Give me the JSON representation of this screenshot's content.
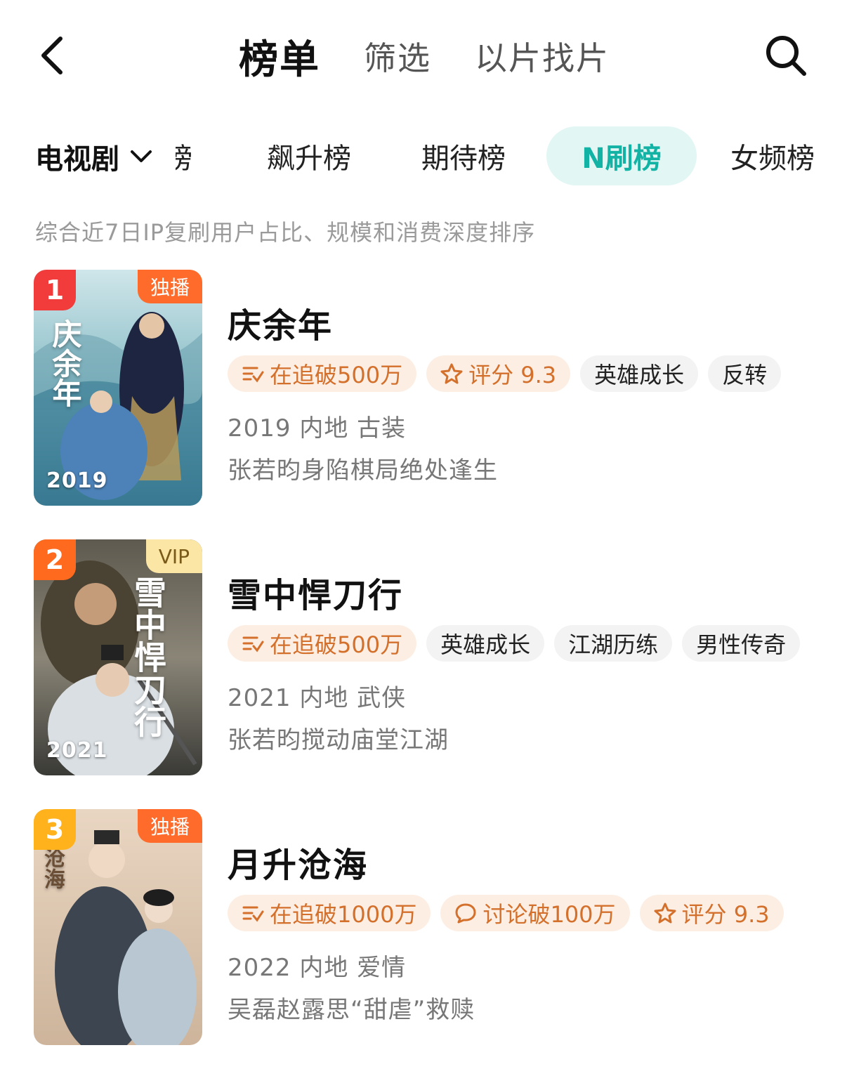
{
  "nav": {
    "tabs": [
      {
        "label": "榜单",
        "active": true
      },
      {
        "label": "筛选",
        "active": false
      },
      {
        "label": "以片找片",
        "active": false
      }
    ],
    "icons": {
      "back": "chevron-left-icon",
      "search": "search-icon"
    }
  },
  "category": {
    "selected": "电视剧",
    "icon": "chevron-down-icon"
  },
  "rank_tabs": [
    {
      "label": "榜",
      "active": false
    },
    {
      "label": "飙升榜",
      "active": false
    },
    {
      "label": "期待榜",
      "active": false
    },
    {
      "label": "N刷榜",
      "active": true
    },
    {
      "label": "女频榜",
      "active": false
    }
  ],
  "description": "综合近7日IP复刷用户占比、规模和消费深度排序",
  "colors": {
    "accent": "#12b3a5",
    "accent_bg": "#e2f6f4",
    "hot_tag_bg": "#fdeee3",
    "hot_tag_text": "#d3702c"
  },
  "items": [
    {
      "rank": "1",
      "rank_color": "#f23c3c",
      "badge": "独播",
      "badge_type": "exclusive",
      "poster_year": "2019",
      "poster_title": "庆余年",
      "title": "庆余年",
      "tags": [
        {
          "text": "在追破500万",
          "icon": "follow-list-icon",
          "style": "hot"
        },
        {
          "text": "评分 9.3",
          "icon": "star-icon",
          "style": "hot"
        },
        {
          "text": "英雄成长",
          "style": "plain"
        },
        {
          "text": "反转",
          "style": "plain"
        }
      ],
      "meta": "2019 内地 古装",
      "subtitle": "张若昀身陷棋局绝处逢生"
    },
    {
      "rank": "2",
      "rank_color": "#ff6a1f",
      "badge": "VIP",
      "badge_type": "vip",
      "poster_year": "2021",
      "poster_title": "雪中悍刀行",
      "title": "雪中悍刀行",
      "tags": [
        {
          "text": "在追破500万",
          "icon": "follow-list-icon",
          "style": "hot"
        },
        {
          "text": "英雄成长",
          "style": "plain"
        },
        {
          "text": "江湖历练",
          "style": "plain"
        },
        {
          "text": "男性传奇",
          "style": "plain"
        }
      ],
      "meta": "2021 内地 武侠",
      "subtitle": "张若昀搅动庙堂江湖"
    },
    {
      "rank": "3",
      "rank_color": "#ffb21c",
      "badge": "独播",
      "badge_type": "exclusive",
      "poster_year": "",
      "poster_title": "沧海",
      "title": "月升沧海",
      "tags": [
        {
          "text": "在追破1000万",
          "icon": "follow-list-icon",
          "style": "hot"
        },
        {
          "text": "讨论破100万",
          "icon": "chat-bubble-icon",
          "style": "hot"
        },
        {
          "text": "评分 9.3",
          "icon": "star-icon",
          "style": "hot"
        }
      ],
      "meta": "2022 内地 爱情",
      "subtitle": "吴磊赵露思“甜虐”救赎"
    }
  ]
}
